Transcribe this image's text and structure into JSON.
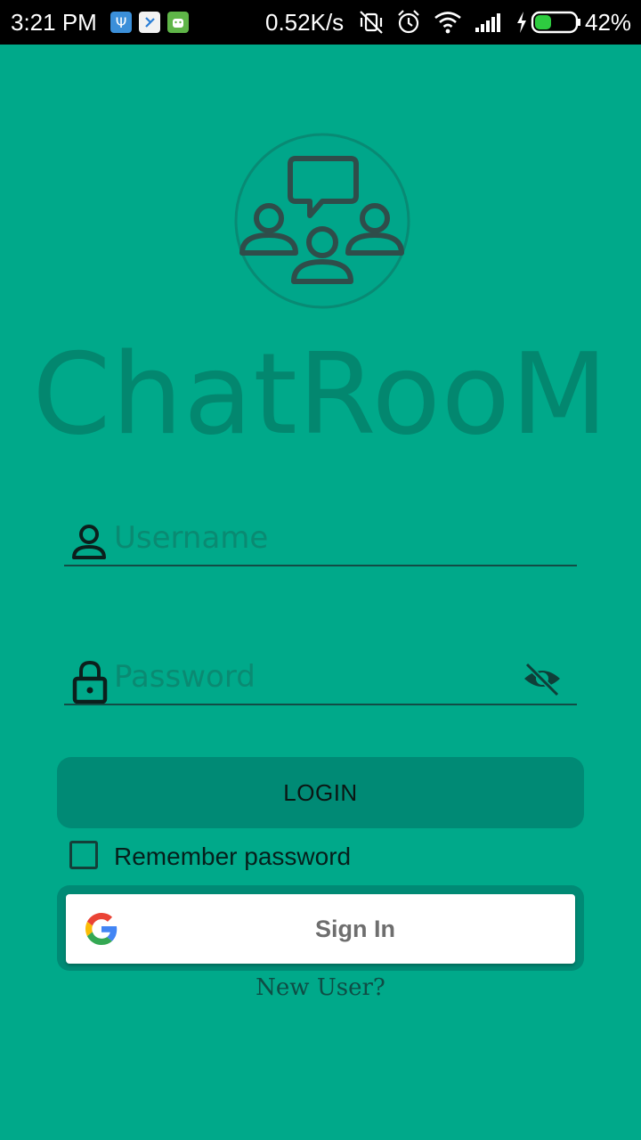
{
  "status_bar": {
    "time": "3:21 PM",
    "network_speed": "0.52K/s",
    "battery": "42%",
    "battery_level": 0.42,
    "notification_icons": [
      "usb-icon",
      "messenger-icon",
      "android-debug-icon"
    ],
    "system_icons": [
      "vibrate-off-icon",
      "alarm-icon",
      "wifi-icon",
      "cell-signal-icon",
      "charging-icon",
      "battery-icon"
    ]
  },
  "app": {
    "title": "ChatRooM",
    "logo_icon": "chat-group-icon"
  },
  "form": {
    "username_placeholder": "Username",
    "password_placeholder": "Password",
    "username_icon": "person-icon",
    "password_icon": "lock-icon",
    "visibility_icon": "visibility-off-icon",
    "login_label": "LOGIN",
    "remember_label": "Remember password",
    "remember_checked": false
  },
  "google": {
    "label": "Sign In",
    "icon": "google-icon"
  },
  "footer": {
    "new_user_link": "New User?"
  },
  "colors": {
    "background": "#00a98a",
    "button": "#008a75",
    "title_text": "#03876f"
  }
}
